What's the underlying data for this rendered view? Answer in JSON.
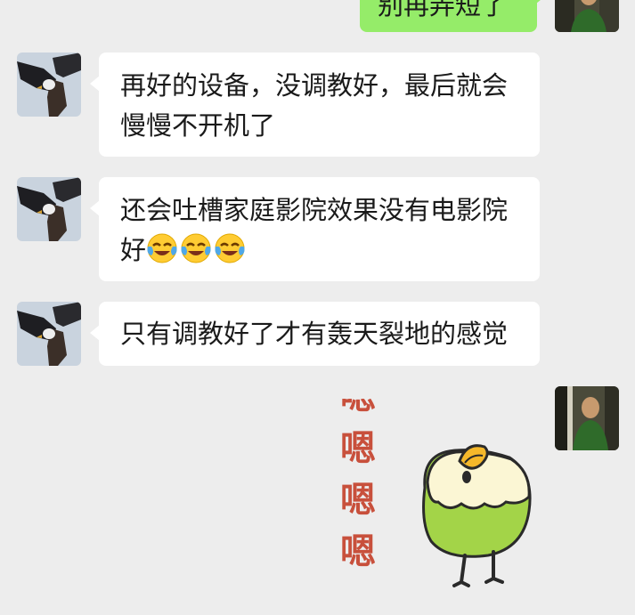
{
  "messages": [
    {
      "sender": "me",
      "text": "别再弄短了"
    },
    {
      "sender": "other",
      "text_line1": "再好的设备，没调教好，最后就会",
      "text_line2": "慢慢不开机了"
    },
    {
      "sender": "other",
      "text_line1": "还会吐槽家庭影院效果没有电影院",
      "text_line2": "好",
      "emoji_count": 3,
      "emoji": "crying-laughing-emoji"
    },
    {
      "sender": "other",
      "text": "只有调教好了才有轰天裂地的感觉"
    },
    {
      "sender": "me",
      "sticker": {
        "text": [
          "嗯",
          "嗯",
          "嗯",
          "嗯"
        ],
        "character": "green-bird-sticker"
      }
    }
  ],
  "colors": {
    "background": "#ededed",
    "my_bubble": "#95ec69",
    "their_bubble": "#ffffff",
    "sticker_text": "#c8503c",
    "sticker_body": "#a3d448"
  }
}
